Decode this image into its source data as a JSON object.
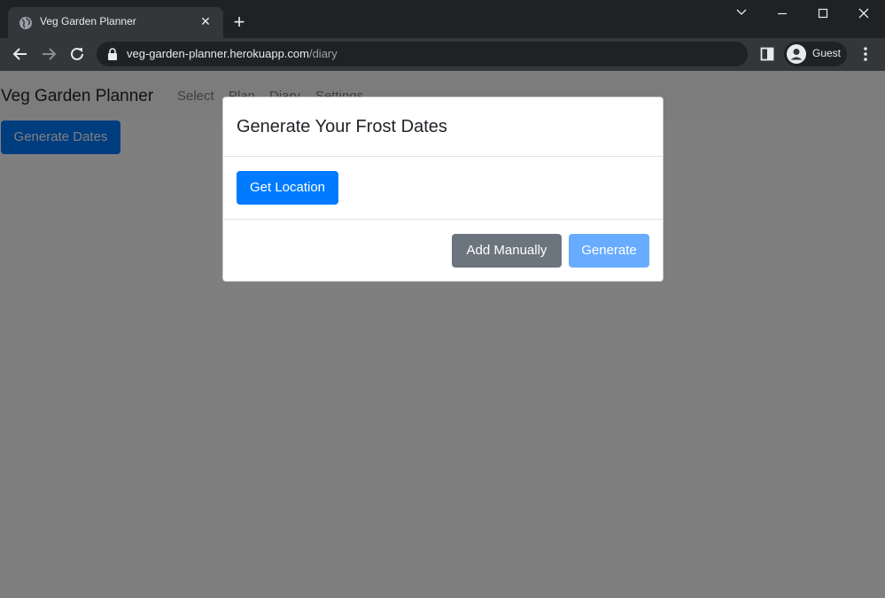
{
  "browser": {
    "tab_title": "Veg Garden Planner",
    "url_host": "veg-garden-planner.herokuapp.com",
    "url_path": "/diary",
    "profile_label": "Guest"
  },
  "page": {
    "brand": "Veg Garden Planner",
    "nav": [
      "Select",
      "Plan",
      "Diary",
      "Settings"
    ],
    "generate_dates_label": "Generate Dates"
  },
  "modal": {
    "title": "Generate Your Frost Dates",
    "get_location_label": "Get Location",
    "add_manually_label": "Add Manually",
    "generate_label": "Generate"
  },
  "colors": {
    "primary": "#007bff",
    "secondary": "#6c757d",
    "primary_disabled": "#68acff",
    "chrome_dark": "#202124",
    "chrome_tab": "#35363a"
  },
  "icons": [
    "globe-icon",
    "close-icon",
    "plus-icon",
    "chevron-down-icon",
    "minimize-icon",
    "maximize-icon",
    "close-window-icon",
    "back-icon",
    "forward-icon",
    "reload-icon",
    "lock-icon",
    "side-panel-icon",
    "avatar-icon",
    "more-vert-icon"
  ]
}
